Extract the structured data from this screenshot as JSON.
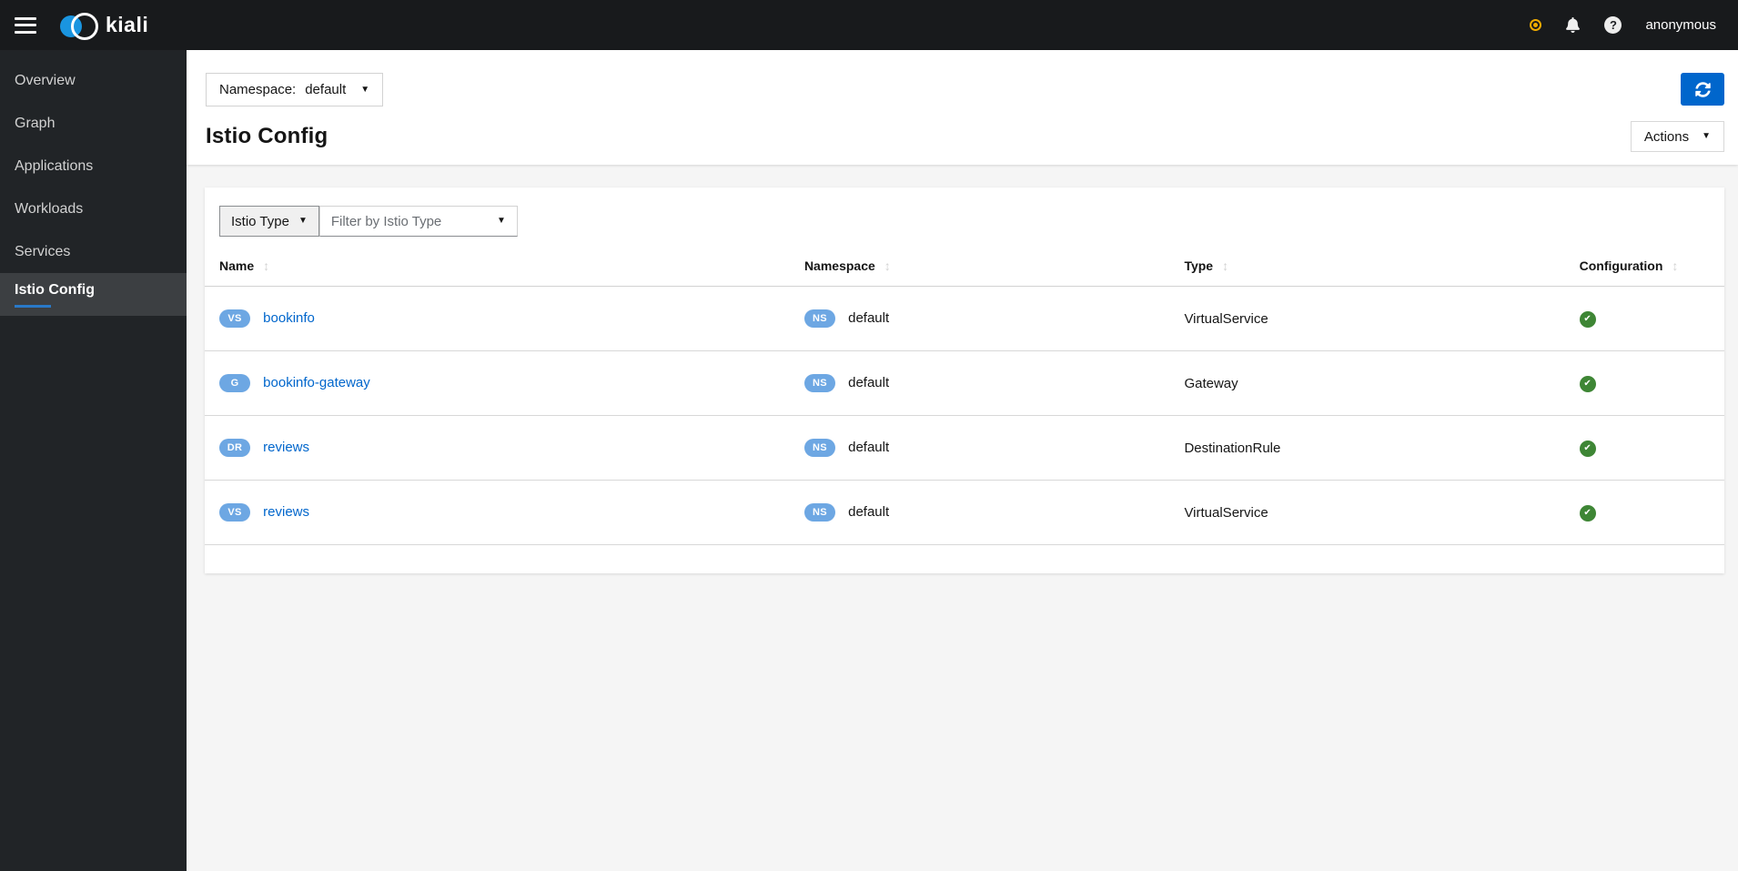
{
  "masthead": {
    "brand": "kiali",
    "user": "anonymous",
    "icons": [
      "status-ring-icon",
      "bell-icon",
      "help-icon"
    ]
  },
  "sidebar": {
    "items": [
      {
        "label": "Overview",
        "active": false
      },
      {
        "label": "Graph",
        "active": false
      },
      {
        "label": "Applications",
        "active": false
      },
      {
        "label": "Workloads",
        "active": false
      },
      {
        "label": "Services",
        "active": false
      },
      {
        "label": "Istio Config",
        "active": true
      }
    ]
  },
  "header": {
    "namespace_label": "Namespace:",
    "namespace_value": "default",
    "title": "Istio Config",
    "actions_label": "Actions"
  },
  "toolbar": {
    "filter_category": "Istio Type",
    "filter_placeholder": "Filter by Istio Type"
  },
  "table": {
    "columns": [
      "Name",
      "Namespace",
      "Type",
      "Configuration"
    ],
    "rows": [
      {
        "badge": "VS",
        "name": "bookinfo",
        "ns_badge": "NS",
        "namespace": "default",
        "type": "VirtualService",
        "config_status": "valid"
      },
      {
        "badge": "G",
        "name": "bookinfo-gateway",
        "ns_badge": "NS",
        "namespace": "default",
        "type": "Gateway",
        "config_status": "valid"
      },
      {
        "badge": "DR",
        "name": "reviews",
        "ns_badge": "NS",
        "namespace": "default",
        "type": "DestinationRule",
        "config_status": "valid"
      },
      {
        "badge": "VS",
        "name": "reviews",
        "ns_badge": "NS",
        "namespace": "default",
        "type": "VirtualService",
        "config_status": "valid"
      }
    ]
  },
  "colors": {
    "masthead_bg": "#181a1c",
    "sidebar_bg": "#212427",
    "active_nav_bg": "#3c3f42",
    "active_underline": "#2979c8",
    "primary_blue": "#0066cc",
    "link_blue": "#0066cc",
    "badge_blue": "#6da7e3",
    "success_green": "#3e8635",
    "warning_gold": "#f0ab00",
    "page_bg": "#f5f5f5"
  }
}
